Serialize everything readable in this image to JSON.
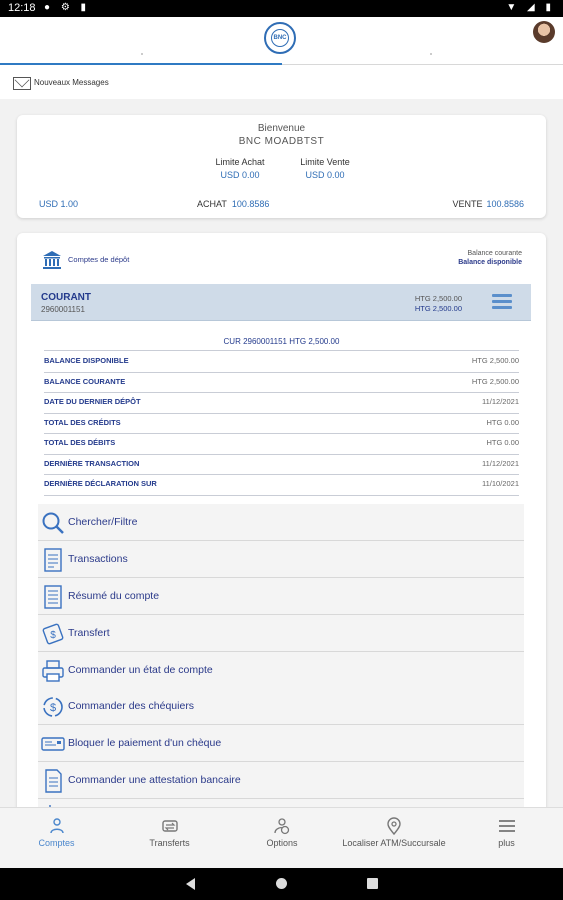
{
  "status_bar": {
    "time": "12:18"
  },
  "messages": {
    "label": "Nouveaux Messages"
  },
  "welcome": {
    "greeting": "Bienvenue",
    "user": "BNC MOADBTST",
    "limit_buy_label": "Limite Achat",
    "limit_buy_value": "USD 0.00",
    "limit_sell_label": "Limite Vente",
    "limit_sell_value": "USD 0.00",
    "usd": "USD 1.00",
    "achat_label": "ACHAT",
    "achat_value": "100.8586",
    "vente_label": "VENTE",
    "vente_value": "100.8586"
  },
  "accounts": {
    "section_label": "Comptes de dépôt",
    "header_balance_current": "Balance courante",
    "header_balance_available": "Balance disponible",
    "account": {
      "type": "COURANT",
      "number": "2960001151",
      "balance_current": "HTG 2,500.00",
      "balance_available": "HTG 2,500.00"
    },
    "detail_title": "CUR 2960001151 HTG 2,500.00",
    "details": [
      {
        "label": "BALANCE DISPONIBLE",
        "value": "HTG 2,500.00"
      },
      {
        "label": "BALANCE COURANTE",
        "value": "HTG 2,500.00"
      },
      {
        "label": "DATE DU DERNIER DÉPÔT",
        "value": "11/12/2021"
      },
      {
        "label": "TOTAL DES CRÉDITS",
        "value": "HTG 0.00"
      },
      {
        "label": "TOTAL DES DÉBITS",
        "value": "HTG 0.00"
      },
      {
        "label": "DERNIÈRE TRANSACTION",
        "value": "11/12/2021"
      },
      {
        "label": "DERNIÈRE DÉCLARATION SUR",
        "value": "11/10/2021"
      }
    ],
    "actions": [
      {
        "label": "Chercher/Filtre",
        "icon": "search-icon"
      },
      {
        "label": "Transactions",
        "icon": "document-list-icon"
      },
      {
        "label": "Résumé du compte",
        "icon": "document-icon"
      },
      {
        "label": "Transfert",
        "icon": "transfer-icon"
      },
      {
        "label": "Commander un état de compte",
        "icon": "printer-icon"
      },
      {
        "label": "Commander des chéquiers",
        "icon": "dollar-cycle-icon"
      },
      {
        "label": "Bloquer le paiement d'un chèque",
        "icon": "cheque-icon"
      },
      {
        "label": "Commander une attestation bancaire",
        "icon": "certificate-icon"
      }
    ]
  },
  "bottom_nav": [
    {
      "label": "Comptes",
      "icon": "accounts-icon",
      "active": true
    },
    {
      "label": "Transferts",
      "icon": "transfers-icon",
      "active": false
    },
    {
      "label": "Options",
      "icon": "options-icon",
      "active": false
    },
    {
      "label": "Localiser ATM/Succursale",
      "icon": "location-pin-icon",
      "active": false
    },
    {
      "label": "plus",
      "icon": "hamburger-menu-icon",
      "active": false
    }
  ],
  "colors": {
    "accent": "#2f6db5",
    "label_blue": "#233a8c",
    "selected_row": "#cfdbe8"
  }
}
